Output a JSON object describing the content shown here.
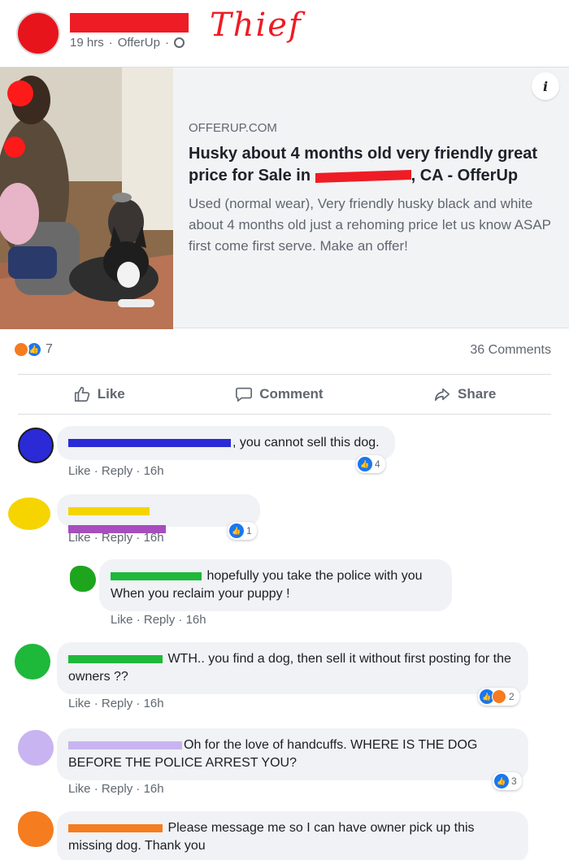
{
  "post": {
    "time": "19 hrs",
    "source": "OfferUp",
    "annotation": "Thief"
  },
  "link": {
    "domain": "OFFERUP.COM",
    "title_before": "Husky about 4 months old very friendly great price for Sale in",
    "title_after": ", CA - OfferUp",
    "description": "Used (normal wear), Very friendly husky black and white about 4 months old just a rehoming price let us know ASAP first come first serve. Make an offer!",
    "info_icon": "i"
  },
  "reactions": {
    "count": "7",
    "comments": "36 Comments"
  },
  "actions": {
    "like": "Like",
    "comment": "Comment",
    "share": "Share"
  },
  "comment_actions": {
    "like": "Like",
    "reply": "Reply",
    "sep": "·"
  },
  "comments": [
    {
      "text": ", you cannot sell this dog.",
      "time": "16h",
      "reactions": "4",
      "avatar_color": "#2222cc",
      "redact_color": "#2a2ad6"
    },
    {
      "text": "",
      "time": "16h",
      "reactions": "1",
      "avatar_color": "#f5d400",
      "redact_color": "#a84cc0"
    },
    {
      "text": " hopefully you take the police with you When you reclaim your puppy !",
      "time": "16h",
      "reactions": "",
      "avatar_color": "#1ea51e",
      "redact_color": "#1eb83a"
    },
    {
      "text": " WTH.. you find a dog, then sell it without first posting for the owners ??",
      "time": "16h",
      "reactions": "2",
      "avatar_color": "#1eb83a",
      "redact_color": "#1eb83a"
    },
    {
      "text": "Oh for the love of handcuffs. WHERE IS THE DOG BEFORE THE POLICE ARREST YOU?",
      "time": "16h",
      "reactions": "3",
      "avatar_color": "#c8b4f0",
      "redact_color": "#c8b4f0"
    },
    {
      "text": " Please message me so I can have owner pick up this missing dog. Thank you",
      "time": "",
      "reactions": "",
      "avatar_color": "#f57c1f",
      "redact_color": "#f57c1f"
    }
  ]
}
